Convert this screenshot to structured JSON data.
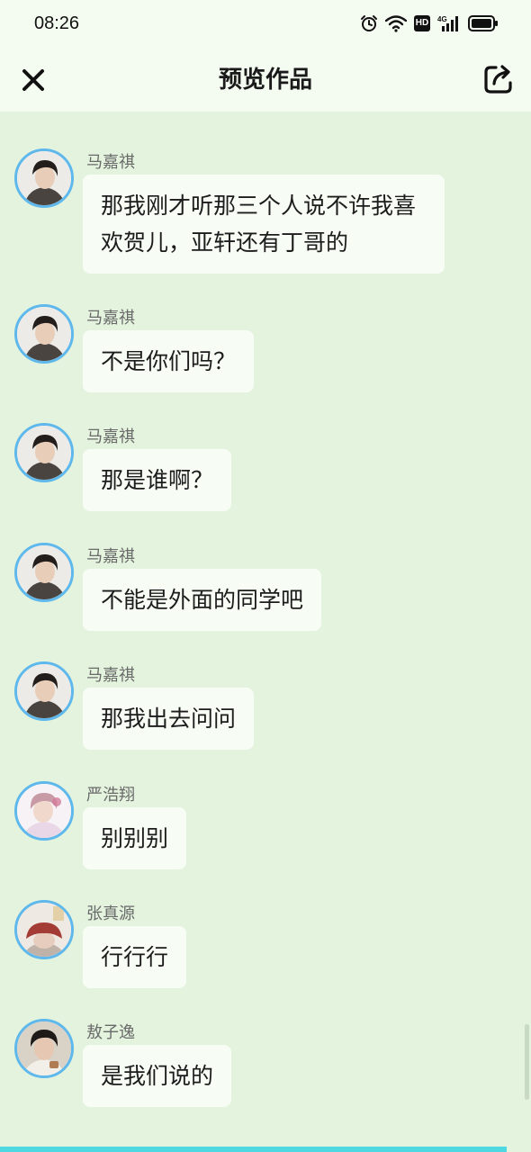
{
  "status_bar": {
    "time": "08:26",
    "hd_label": "HD",
    "network_label": "4G"
  },
  "header": {
    "title": "预览作品",
    "close_icon": "close-icon",
    "share_icon": "share-export-icon"
  },
  "colors": {
    "background": "#e3f3dd",
    "header_background": "#f4fbf0",
    "bubble": "#f7fcf4",
    "avatar_border": "#5eb8ec",
    "bottom_accent": "#4fd7e2"
  },
  "messages": [
    {
      "sender": "马嘉祺",
      "text": "那我刚才听那三个人说不许我喜欢贺儿，亚轩还有丁哥的",
      "avatar": "avatar-majiaqi"
    },
    {
      "sender": "马嘉祺",
      "text": "不是你们吗？",
      "avatar": "avatar-majiaqi"
    },
    {
      "sender": "马嘉祺",
      "text": "那是谁啊？",
      "avatar": "avatar-majiaqi"
    },
    {
      "sender": "马嘉祺",
      "text": "不能是外面的同学吧",
      "avatar": "avatar-majiaqi"
    },
    {
      "sender": "马嘉祺",
      "text": "那我出去问问",
      "avatar": "avatar-majiaqi"
    },
    {
      "sender": "严浩翔",
      "text": "别别别",
      "avatar": "avatar-yanhaoxiang"
    },
    {
      "sender": "张真源",
      "text": "行行行",
      "avatar": "avatar-zhangzhenyuan"
    },
    {
      "sender": "敖子逸",
      "text": "是我们说的",
      "avatar": "avatar-aoziyi"
    }
  ]
}
